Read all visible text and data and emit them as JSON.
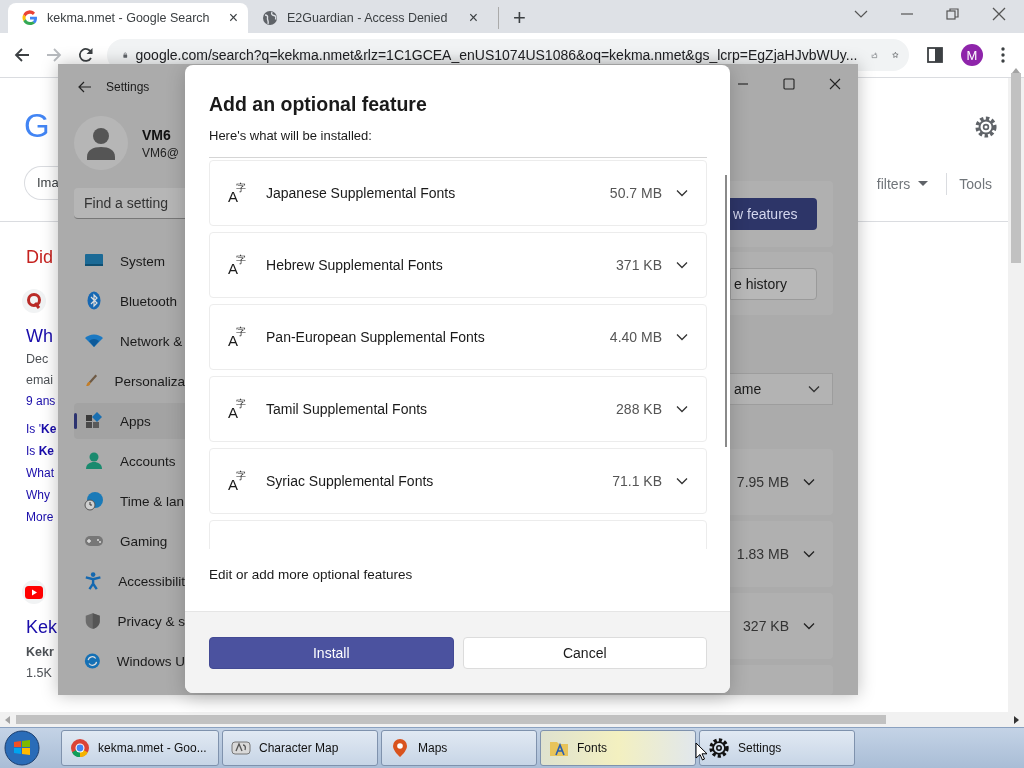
{
  "browser": {
    "tabs": [
      {
        "title": "kekma.nmet - Google Search",
        "kind": "google",
        "selected": true,
        "close": "×"
      },
      {
        "title": "E2Guardian - Access Denied",
        "kind": "globe",
        "selected": false,
        "close": "×"
      }
    ],
    "new_tab": "+",
    "nav": [
      {
        "kind": "back",
        "disabled": false
      },
      {
        "kind": "forward",
        "disabled": true
      },
      {
        "kind": "reload",
        "disabled": false
      }
    ],
    "address": "google.com/search?q=kekma.nmet&rlz=1C1GCEA_enUS1074US1086&oq=kekma.nmet&gs_lcrp=EgZjaHJvbWUy...",
    "profile_initial": "M"
  },
  "page": {
    "logo": "G",
    "chip": "Ima",
    "filters": "filters",
    "tools": "Tools",
    "results": [
      {
        "kind": "suggestion",
        "text": "Did"
      },
      {
        "kind": "forum"
      },
      {
        "kind": "title",
        "text": "Wh"
      },
      {
        "kind": "meta",
        "text": "Dec"
      },
      {
        "kind": "meta",
        "text": "emai"
      },
      {
        "kind": "answers",
        "text": "9 ans"
      },
      {
        "kind": "question",
        "text": "Is '**Ke**"
      },
      {
        "kind": "question",
        "text": "Is **Ke**"
      },
      {
        "kind": "question",
        "text": "What"
      },
      {
        "kind": "question",
        "text": "Why"
      },
      {
        "kind": "question",
        "text": "More"
      },
      {
        "kind": "video"
      },
      {
        "kind": "title",
        "text": "Kek"
      },
      {
        "kind": "bold",
        "text": "Kekr"
      },
      {
        "kind": "meta",
        "text": "1.5K"
      }
    ]
  },
  "settings": {
    "title": "Settings",
    "user": {
      "name": "VM6",
      "email": "VM6@"
    },
    "search": {
      "placeholder": "Find a setting"
    },
    "nav": [
      {
        "label": "System",
        "selected": false
      },
      {
        "label": "Bluetooth",
        "selected": false
      },
      {
        "label": "Network &",
        "selected": false
      },
      {
        "label": "Personaliza",
        "selected": false
      },
      {
        "label": "Apps",
        "selected": true
      },
      {
        "label": "Accounts",
        "selected": false
      },
      {
        "label": "Time & lan",
        "selected": false
      },
      {
        "label": "Gaming",
        "selected": false
      },
      {
        "label": "Accessibilit",
        "selected": false
      },
      {
        "label": "Privacy & s",
        "selected": false
      },
      {
        "label": "Windows U",
        "selected": false
      }
    ],
    "panel": {
      "primary_button": "w features",
      "secondary_button": "e history",
      "sort_dropdown": "ame",
      "sizes": [
        "7.95 MB",
        "1.83 MB",
        "327 KB"
      ]
    }
  },
  "dialog": {
    "title": "Add an optional feature",
    "subtitle": "Here's what will be installed:",
    "features": [
      {
        "icon": "A字",
        "name": "Japanese Supplemental Fonts",
        "size": "50.7 MB"
      },
      {
        "icon": "A字",
        "name": "Hebrew Supplemental Fonts",
        "size": "371 KB"
      },
      {
        "icon": "A字",
        "name": "Pan-European Supplemental Fonts",
        "size": "4.40 MB"
      },
      {
        "icon": "A字",
        "name": "Tamil Supplemental Fonts",
        "size": "288 KB"
      },
      {
        "icon": "A字",
        "name": "Syriac Supplemental Fonts",
        "size": "71.1 KB"
      }
    ],
    "link": "Edit or add more optional features",
    "buttons": [
      {
        "label": "Install",
        "kind": "primary"
      },
      {
        "label": "Cancel",
        "kind": "secondary"
      }
    ]
  },
  "taskbar": {
    "items": [
      {
        "label": "kekma.nmet - Goo...",
        "kind": "chrome",
        "hovered": false
      },
      {
        "label": "Character Map",
        "kind": "charmap",
        "hovered": false
      },
      {
        "label": "Maps",
        "kind": "maps",
        "hovered": false
      },
      {
        "label": "Fonts",
        "kind": "fonts",
        "hovered": true
      },
      {
        "label": "Settings",
        "kind": "settings",
        "hovered": false
      }
    ]
  }
}
